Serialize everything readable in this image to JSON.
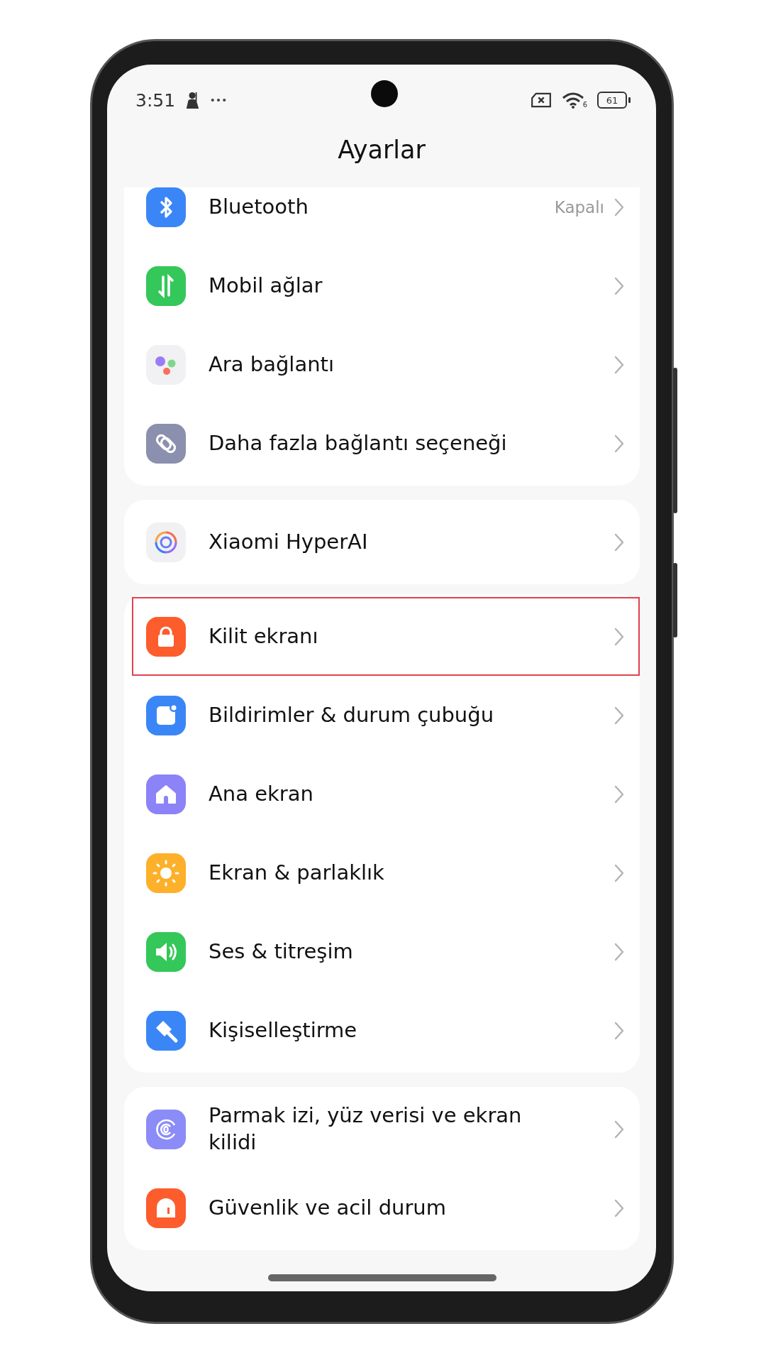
{
  "status_bar": {
    "time": "3:51",
    "wifi_number": "6",
    "battery": "61"
  },
  "title": "Ayarlar",
  "groups": [
    {
      "items": [
        {
          "kind": "bluetooth",
          "label": "Bluetooth",
          "value": "Kapalı",
          "highlighted": false
        },
        {
          "kind": "mobile",
          "label": "Mobil ağlar",
          "highlighted": false
        },
        {
          "kind": "dots",
          "label": "Ara bağlantı",
          "highlighted": false
        },
        {
          "kind": "link",
          "label": "Daha fazla bağlantı seçeneği",
          "highlighted": false
        }
      ]
    },
    {
      "items": [
        {
          "kind": "ai",
          "label": "Xiaomi HyperAI",
          "highlighted": false
        }
      ]
    },
    {
      "items": [
        {
          "kind": "lock",
          "label": "Kilit ekranı",
          "highlighted": true
        },
        {
          "kind": "notify",
          "label": "Bildirimler & durum çubuğu",
          "highlighted": false
        },
        {
          "kind": "home",
          "label": "Ana ekran",
          "highlighted": false
        },
        {
          "kind": "sun",
          "label": "Ekran & parlaklık",
          "highlighted": false
        },
        {
          "kind": "sound",
          "label": "Ses & titreşim",
          "highlighted": false
        },
        {
          "kind": "brush",
          "label": "Kişiselleştirme",
          "highlighted": false
        }
      ]
    },
    {
      "items": [
        {
          "kind": "finger",
          "label": "Parmak izi, yüz verisi ve ekran kilidi",
          "highlighted": false
        },
        {
          "kind": "alarm",
          "label": "Güvenlik ve acil durum",
          "highlighted": false
        }
      ]
    }
  ]
}
